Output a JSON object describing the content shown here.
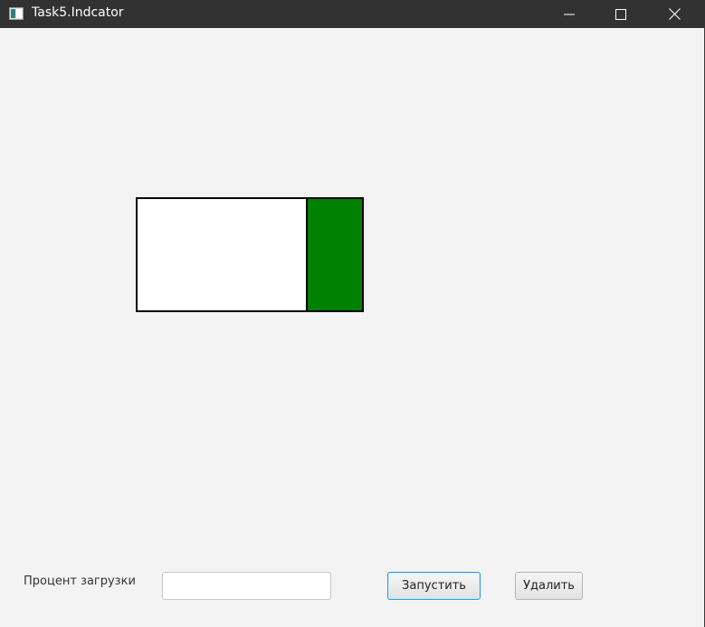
{
  "window": {
    "title": "Task5.Indcator",
    "icon": "java-app-icon",
    "controls": {
      "minimize_icon": "minimize-icon",
      "maximize_icon": "maximize-icon",
      "close_icon": "close-icon"
    }
  },
  "indicator": {
    "fill_fraction": 0.25,
    "fill_color": "#008000",
    "empty_color": "#ffffff",
    "border_color": "#000000"
  },
  "controls": {
    "percent_label": "Процент загрузки",
    "percent_input_value": "",
    "start_button_label": "Запустить",
    "delete_button_label": "Удалить"
  },
  "colors": {
    "titlebar": "#323232",
    "background": "#f3f3f3",
    "focus_border": "#2b9be0"
  }
}
